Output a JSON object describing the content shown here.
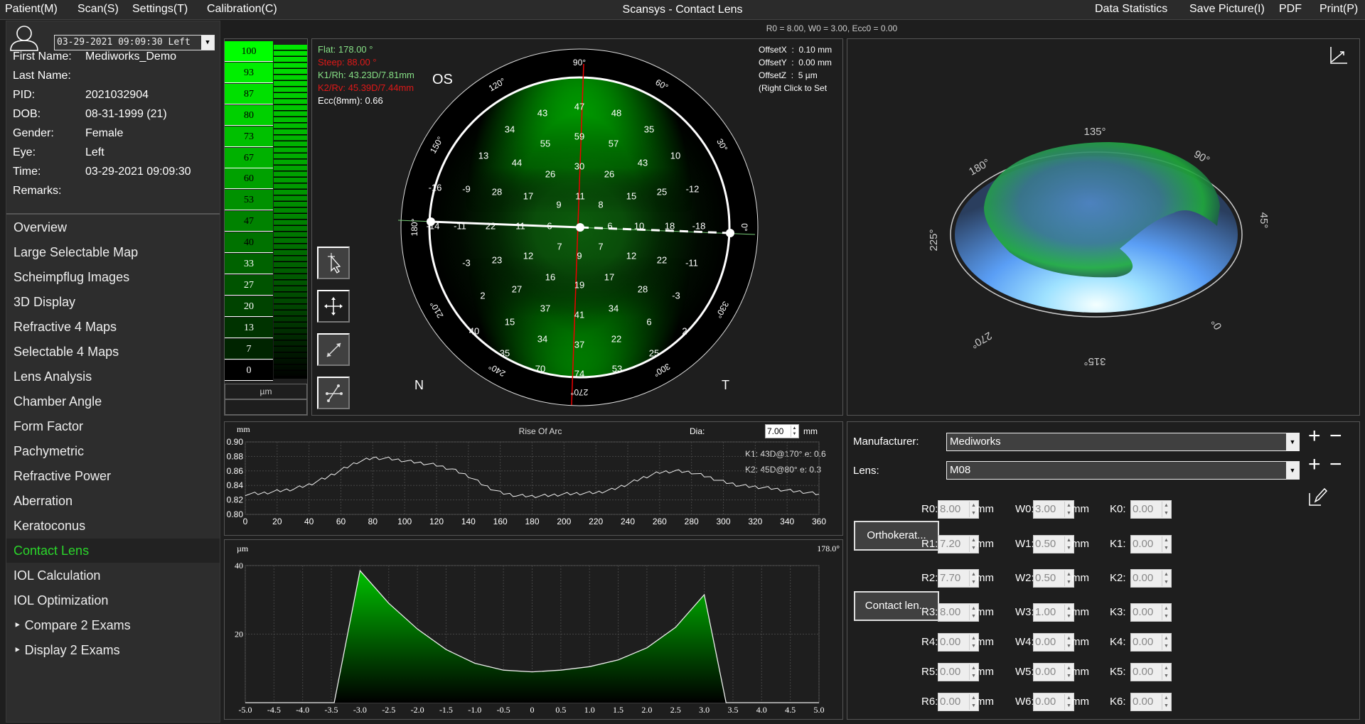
{
  "menu": {
    "left": [
      "Patient(M)",
      "Scan(S)",
      "Settings(T)",
      "Calibration(C)"
    ],
    "title": "Scansys - Contact Lens",
    "right": [
      "Data Statistics",
      "Save Picture(I)",
      "PDF",
      "Print(P)"
    ]
  },
  "patient": {
    "exam_select": "03-29-2021 09:09:30 Left",
    "fields": [
      {
        "label": "First Name:",
        "value": "Mediworks_Demo"
      },
      {
        "label": "Last Name:",
        "value": ""
      },
      {
        "label": "PID:",
        "value": "2021032904"
      },
      {
        "label": "DOB:",
        "value": "08-31-1999  (21)"
      },
      {
        "label": "Gender:",
        "value": "Female"
      },
      {
        "label": "Eye:",
        "value": "Left"
      },
      {
        "label": "Time:",
        "value": "03-29-2021 09:09:30"
      },
      {
        "label": "Remarks:",
        "value": ""
      }
    ]
  },
  "nav": {
    "items": [
      "Overview",
      "Large Selectable Map",
      "Scheimpflug Images",
      "3D Display",
      "Refractive 4 Maps",
      "Selectable 4 Maps",
      "Lens Analysis",
      "Chamber Angle",
      "Form Factor",
      "Pachymetric",
      "Refractive Power",
      "Aberration",
      "Keratoconus",
      "Contact Lens",
      "IOL Calculation",
      "IOL Optimization",
      "‣  Compare 2 Exams",
      "‣  Display 2 Exams"
    ],
    "active_index": 13,
    "active_color": "#2bd62b"
  },
  "lens_summary": "R0 = 8.00, W0 = 3.00, Ecc0 = 0.00",
  "color_scale": {
    "values": [
      "100",
      "93",
      "87",
      "80",
      "73",
      "67",
      "60",
      "53",
      "47",
      "40",
      "33",
      "27",
      "20",
      "13",
      "7",
      "0"
    ],
    "unit": "µm"
  },
  "map": {
    "eye": "OS",
    "nasal": "N",
    "temporal": "T",
    "info": [
      {
        "text": "Flat: 178.00 °",
        "color": "#86e086"
      },
      {
        "text": "Steep: 88.00 °",
        "color": "#e01818"
      },
      {
        "text": "K1/Rh: 43.23D/7.81mm",
        "color": "#86e086"
      },
      {
        "text": "K2/Rv: 45.39D/7.44mm",
        "color": "#e01818"
      },
      {
        "text": "Ecc(8mm): 0.66",
        "color": "#ffffff"
      }
    ],
    "offsets": [
      "OffsetX  :  0.10 mm",
      "OffsetY  :  0.00 mm",
      "OffsetZ  :  5 µm",
      "(Right Click to Set"
    ],
    "angle_labels": [
      "0°",
      "30°",
      "60°",
      "90°",
      "120°",
      "150°",
      "180°",
      "210°",
      "240°",
      "270°",
      "300°",
      "330°"
    ],
    "values": [
      "47",
      "43",
      "48",
      "34",
      "35",
      "59",
      "55",
      "57",
      "13",
      "10",
      "44",
      "43",
      "30",
      "26",
      "26",
      "-16",
      "-9",
      "28",
      "17",
      "11",
      "15",
      "25",
      "-12",
      "9",
      "8",
      "-14",
      "-11",
      "22",
      "11",
      "6",
      "6",
      "10",
      "18",
      "-18",
      "7",
      "7",
      "-3",
      "23",
      "12",
      "9",
      "12",
      "22",
      "-11",
      "16",
      "17",
      "19",
      "27",
      "28",
      "2",
      "-3",
      "37",
      "34",
      "41",
      "15",
      "6",
      "40",
      "2",
      "34",
      "22",
      "37",
      "35",
      "25",
      "70",
      "74",
      "53"
    ],
    "tools": [
      "select-cursor-icon",
      "move-icon",
      "measure-line-icon",
      "axis-adjust-icon"
    ]
  },
  "view3d": {
    "angle_labels": [
      "135°",
      "90°",
      "45°",
      "0°",
      "315°",
      "270°",
      "225°",
      "180°"
    ]
  },
  "rise_panel": {
    "dia_label": "Dia:",
    "dia_value": "7.00",
    "dia_unit": "mm",
    "k1": "K1: 43D@170° e: 0.6",
    "k2": "K2: 45D@80° e: 0.3"
  },
  "chart_data": [
    {
      "type": "line",
      "title": "Rise Of Arc",
      "ylabel": "mm",
      "xlim": [
        0,
        360
      ],
      "ylim": [
        0.8,
        0.9
      ],
      "xticks": [
        0,
        20,
        40,
        60,
        80,
        100,
        120,
        140,
        160,
        180,
        200,
        220,
        240,
        260,
        280,
        300,
        320,
        340,
        360
      ],
      "yticks": [
        "0.90",
        "0.88",
        "0.86",
        "0.84",
        "0.82",
        "0.80"
      ],
      "grid": true,
      "x": [
        0,
        10,
        20,
        30,
        40,
        50,
        60,
        70,
        80,
        90,
        100,
        110,
        120,
        130,
        140,
        150,
        160,
        170,
        180,
        190,
        200,
        210,
        220,
        230,
        240,
        250,
        260,
        270,
        280,
        290,
        300,
        310,
        320,
        330,
        340,
        350,
        360
      ],
      "y": [
        0.828,
        0.829,
        0.832,
        0.835,
        0.841,
        0.85,
        0.861,
        0.872,
        0.878,
        0.877,
        0.874,
        0.871,
        0.868,
        0.862,
        0.853,
        0.84,
        0.83,
        0.826,
        0.825,
        0.826,
        0.828,
        0.829,
        0.83,
        0.834,
        0.842,
        0.851,
        0.858,
        0.86,
        0.858,
        0.852,
        0.845,
        0.84,
        0.838,
        0.836,
        0.833,
        0.831,
        0.828
      ]
    },
    {
      "type": "area",
      "title": "178.0°",
      "ylabel": "µm",
      "xlim": [
        -5,
        5
      ],
      "ylim": [
        0,
        40
      ],
      "xticks": [
        "-5.0",
        "-4.5",
        "-4.0",
        "-3.5",
        "-3.0",
        "-2.5",
        "-2.0",
        "-1.5",
        "-1.0",
        "-0.5",
        "0",
        "0.5",
        "1.0",
        "1.5",
        "2.0",
        "2.5",
        "3.0",
        "3.5",
        "4.0",
        "4.5",
        "5.0"
      ],
      "yticks": [
        "40",
        "20"
      ],
      "grid": true,
      "x": [
        -5,
        -3.5,
        -3.45,
        -3.0,
        -2.5,
        -2.0,
        -1.5,
        -1.0,
        -0.5,
        0,
        0.5,
        1.0,
        1.5,
        2.0,
        2.5,
        3.0,
        3.38,
        3.5,
        5
      ],
      "y": [
        0,
        0,
        0,
        38.5,
        29,
        21.5,
        15.5,
        11.5,
        9.5,
        9,
        9.5,
        10.5,
        12.5,
        16,
        22,
        31.5,
        0,
        0,
        0
      ],
      "fill_color": "#00c000"
    }
  ],
  "lens_panel": {
    "manufacturer_label": "Manufacturer:",
    "manufacturer_value": "Mediworks",
    "lens_label": "Lens:",
    "lens_value": "M08",
    "orthok_button": "Orthokerat...",
    "contact_button": "Contact len...",
    "unit": "mm",
    "rows": [
      {
        "r": "R0:",
        "rv": "8.00",
        "w": "W0:",
        "wv": "3.00",
        "k": "K0:",
        "kv": "0.00"
      },
      {
        "r": "R1:",
        "rv": "7.20",
        "w": "W1:",
        "wv": "0.50",
        "k": "K1:",
        "kv": "0.00"
      },
      {
        "r": "R2:",
        "rv": "7.70",
        "w": "W2:",
        "wv": "0.50",
        "k": "K2:",
        "kv": "0.00"
      },
      {
        "r": "R3:",
        "rv": "8.00",
        "w": "W3:",
        "wv": "1.00",
        "k": "K3:",
        "kv": "0.00"
      },
      {
        "r": "R4:",
        "rv": "0.00",
        "w": "W4:",
        "wv": "0.00",
        "k": "K4:",
        "kv": "0.00"
      },
      {
        "r": "R5:",
        "rv": "0.00",
        "w": "W5:",
        "wv": "0.00",
        "k": "K5:",
        "kv": "0.00"
      },
      {
        "r": "R6:",
        "rv": "0.00",
        "w": "W6:",
        "wv": "0.00",
        "k": "K6:",
        "kv": "0.00"
      }
    ]
  }
}
